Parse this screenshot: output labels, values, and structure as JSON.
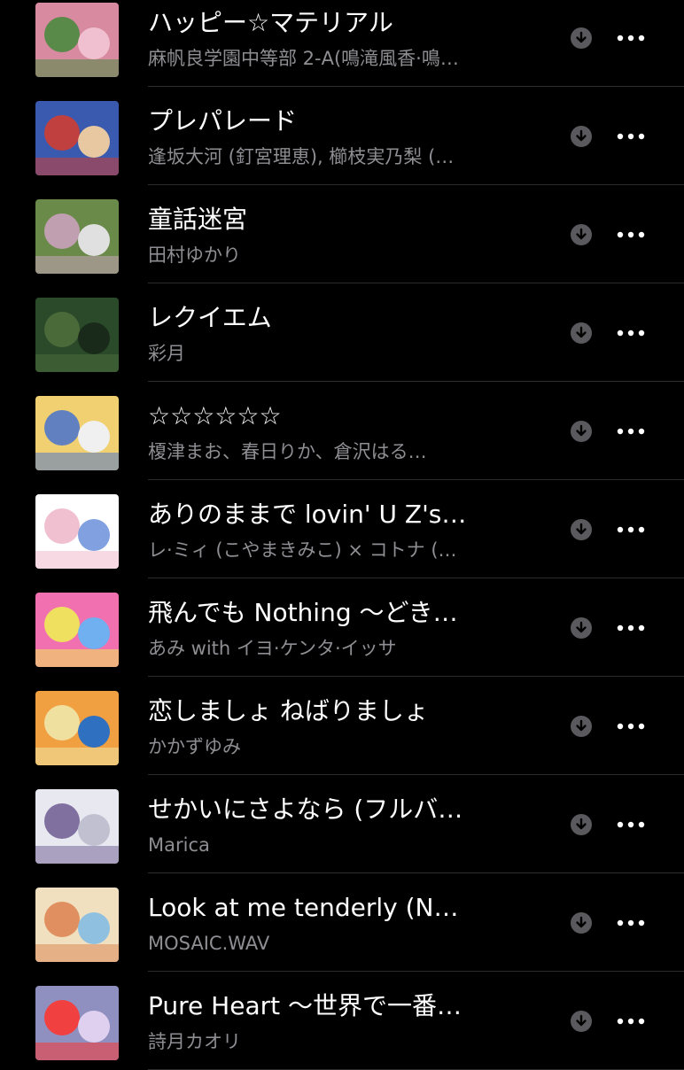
{
  "colors": {
    "background": "#000000",
    "title": "#ffffff",
    "subtitle": "#8e8e93",
    "icon": "#5a5a5e",
    "divider": "#2c2c2e"
  },
  "tracks": [
    {
      "title": "ハッピー☆マテリアル",
      "artist": "麻帆良学園中等部 2-A(鳴滝風香·鳴…",
      "art_colors": [
        "#d88aa0",
        "#5a8a4a",
        "#f0c0d0"
      ]
    },
    {
      "title": "プレパレード",
      "artist": "逢坂大河 (釘宮理恵), 櫛枝実乃梨 (…",
      "art_colors": [
        "#3a5ab0",
        "#c04040",
        "#e8c8a0"
      ]
    },
    {
      "title": "童話迷宮",
      "artist": "田村ゆかり",
      "art_colors": [
        "#6a8a4a",
        "#c0a0b0",
        "#e0e0e0"
      ]
    },
    {
      "title": "レクイエム",
      "artist": "彩月",
      "art_colors": [
        "#2a4a2a",
        "#4a6a3a",
        "#1a2a1a"
      ]
    },
    {
      "title": "☆☆☆☆☆☆",
      "artist": "榎津まお、春日りか、倉沢はる…",
      "art_colors": [
        "#f0d070",
        "#6080c0",
        "#f0f0f0"
      ]
    },
    {
      "title": "ありのままで lovin' U Z's…",
      "artist": "レ·ミィ (こやまきみこ) × コトナ (…",
      "art_colors": [
        "#ffffff",
        "#f0c0d0",
        "#80a0e0"
      ]
    },
    {
      "title": "飛んでも Nothing ～どき…",
      "artist": "あみ with イヨ·ケンタ·イッサ",
      "art_colors": [
        "#f070b0",
        "#f0e060",
        "#70b0f0"
      ]
    },
    {
      "title": "恋しましょ ねばりましょ",
      "artist": "かかずゆみ",
      "art_colors": [
        "#f0a040",
        "#f0e0a0",
        "#3070c0"
      ]
    },
    {
      "title": "せかいにさよなら (フルバ…",
      "artist": "Marica",
      "art_colors": [
        "#e8e8f0",
        "#8070a0",
        "#c0c0d0"
      ]
    },
    {
      "title": "Look at me tenderly (N…",
      "artist": "MOSAIC.WAV",
      "art_colors": [
        "#f0e0c0",
        "#e09060",
        "#90c0e0"
      ]
    },
    {
      "title": "Pure Heart ～世界で一番…",
      "artist": "詩月カオリ",
      "art_colors": [
        "#9090c0",
        "#f04040",
        "#e0d0f0"
      ]
    }
  ]
}
